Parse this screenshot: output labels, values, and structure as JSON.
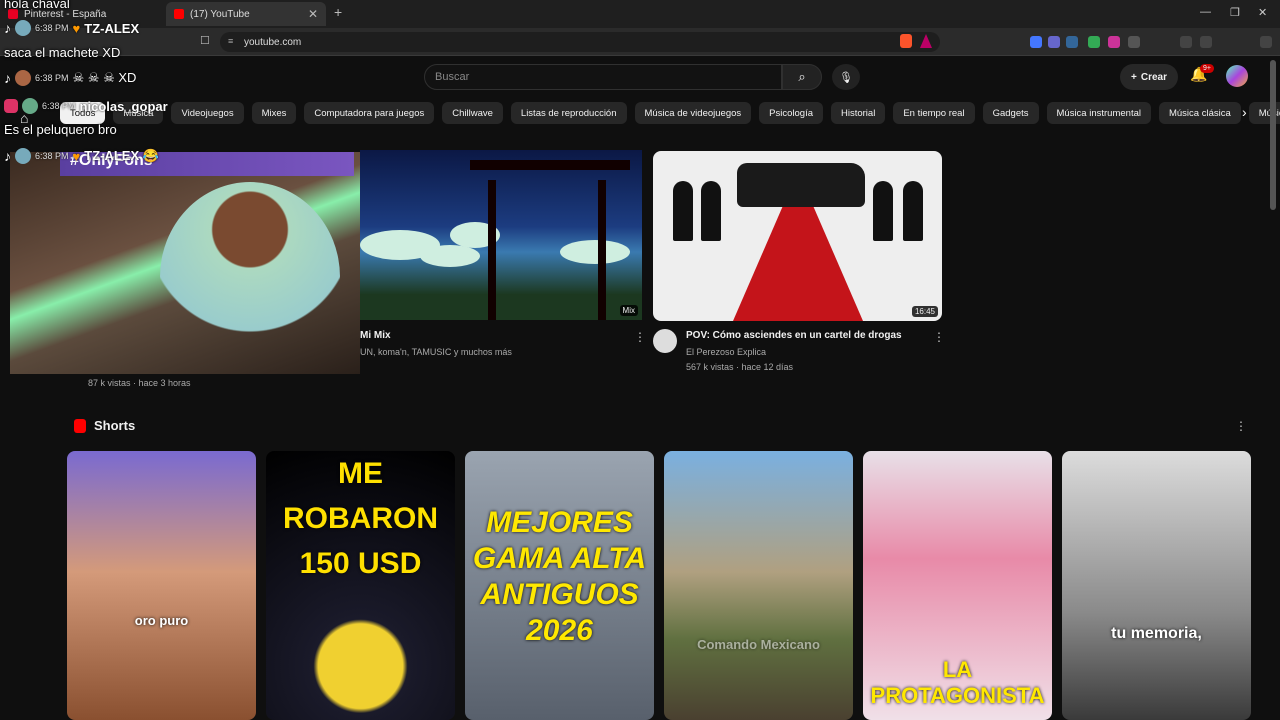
{
  "browser": {
    "tabs": [
      {
        "label": "Pinterest - España",
        "color": "#e60023"
      },
      {
        "label": "(17) YouTube",
        "color": "#ff0000"
      }
    ],
    "address": "youtube.com",
    "new_tab_icon": "plus-icon"
  },
  "youtube": {
    "search_placeholder": "Buscar",
    "create_label": "Crear",
    "notif_count": "9+",
    "chips": [
      "Todos",
      "Música",
      "Videojuegos",
      "Mixes",
      "Computadora para juegos",
      "Chillwave",
      "Listas de reproducción",
      "Música de videojuegos",
      "Psicología",
      "Historial",
      "En tiempo real",
      "Gadgets",
      "Música instrumental",
      "Música clásica",
      "Música l"
    ]
  },
  "overlay": {
    "lines": [
      {
        "text": "hola chaval"
      },
      {
        "name": "TZ-ALEX",
        "time": "6:38 PM"
      },
      {
        "text": "saca el machete XD"
      },
      {
        "name": "☠ ☠ ☠  XD",
        "time": "6:38 PM"
      },
      {
        "name": "nicolas_gopar",
        "time": "6:38 PM"
      },
      {
        "text": "Es el peluquero bro"
      },
      {
        "name": "TZ-ALEX 😂",
        "time": "6:38 PM"
      }
    ]
  },
  "videos": [
    {
      "banner": "#OnlyFons",
      "meta": "87 k vistas · hace 3 horas"
    },
    {
      "title": "Mi Mix",
      "sub": "UN, koma'n, TAMUSIC y muchos más",
      "badge": "Mix"
    },
    {
      "title": "POV: Cómo asciendes en un cartel de drogas",
      "channel": "El Perezoso Explica",
      "meta": "567 k vistas · hace 12 días",
      "duration": "16:45"
    }
  ],
  "shorts": {
    "title": "Shorts",
    "items": [
      {
        "caption": "oro puro"
      },
      {
        "caption": "ME ROBARON 150 USD"
      },
      {
        "caption": "MEJORES GAMA ALTA ANTIGUOS 2026"
      },
      {
        "caption": "Comando Mexicano"
      },
      {
        "caption": "LA PROTAGONISTA"
      },
      {
        "caption": "tu memoria,"
      }
    ]
  }
}
